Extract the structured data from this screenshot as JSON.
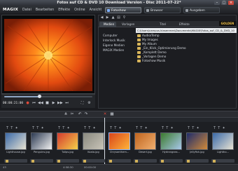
{
  "window": {
    "title": "Fotos auf CD & DVD 10 Download Version - Disc 2011-07-22*"
  },
  "menubar": {
    "logo": "MAGIX",
    "items": [
      "Datei",
      "Bearbeiten",
      "Effekte",
      "Online",
      "Ansicht",
      "Hilfe"
    ]
  },
  "modes": {
    "photos": "Fotoshow",
    "browse": "Browser",
    "output": "Ausgeben"
  },
  "preview": {
    "timecode": "00:00:21:00"
  },
  "media": {
    "tabs": [
      "Medien",
      "Vorlagen",
      "Titel",
      "Effekte"
    ],
    "badge": "GOLDEN",
    "path": "C:\\Users\\campus.klasenmes\\Documents\\MAGIX\\Fotos_auf_CD_&_DVD_10",
    "tree": [
      "Computer",
      "Interlock Musik",
      "Eigene Medien",
      "MAGIX Medien"
    ],
    "files": [
      "Audio/Temp",
      "My Images",
      "My Album",
      "_Ein_Klick_Optimierung Demo",
      "_Komplett Demo",
      "_Vorlagen Demo",
      "Fotoshow Musik"
    ]
  },
  "timeline": {
    "thumbs": [
      {
        "name": "Lighthouse.jpg",
        "icon": "lighthouse-thumbnail"
      },
      {
        "name": "Penguins.jpg",
        "icon": "penguins-thumbnail"
      },
      {
        "name": "Tulips.jpg",
        "icon": "tulips-thumbnail"
      },
      {
        "name": "Koala.jpg",
        "icon": "koala-thumbnail"
      },
      {
        "name": "Chrysanthem...",
        "icon": "chrysanthemum-thumbnail"
      },
      {
        "name": "Desert.jpg",
        "icon": "desert-thumbnail"
      },
      {
        "name": "Hydrangeas...",
        "icon": "hydrangeas-thumbnail"
      },
      {
        "name": "Jellyfish.jpg",
        "icon": "jellyfish-thumbnail"
      },
      {
        "name": "Lightho...",
        "icon": "lighthouse-thumbnail"
      }
    ]
  },
  "statusbar": {
    "count": "43",
    "duration1": "4:58:30",
    "duration2": "00:00:00"
  },
  "colors": {
    "accent": "#8ea6c4",
    "folder": "#d8b55a",
    "badge": "#f3c34a"
  }
}
